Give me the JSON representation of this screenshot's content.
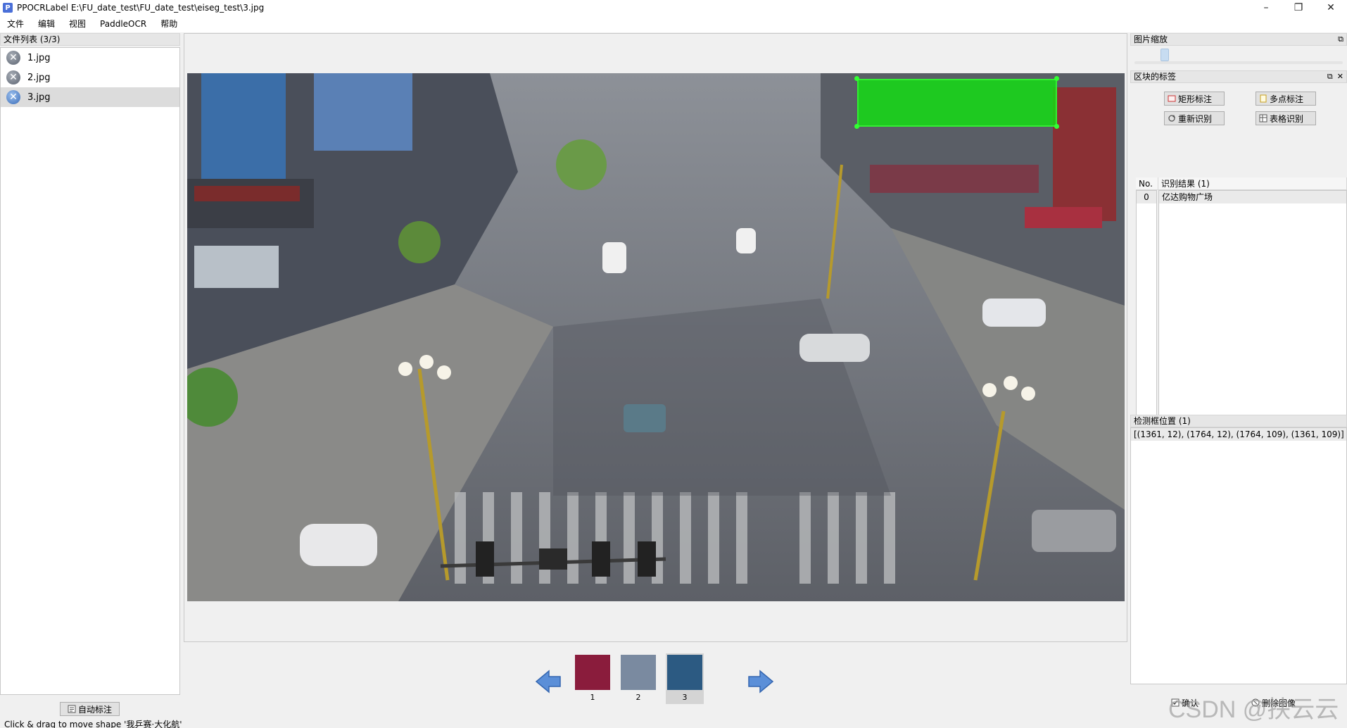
{
  "window": {
    "title": "PPOCRLabel E:\\FU_date_test\\FU_date_test\\eiseg_test\\3.jpg",
    "icon_letter": "P",
    "controls": {
      "minimize": "–",
      "restore": "❐",
      "close": "✕"
    }
  },
  "menu": [
    "文件",
    "编辑",
    "视图",
    "PaddleOCR",
    "帮助"
  ],
  "file_list": {
    "title": "文件列表 (3/3)",
    "items": [
      {
        "name": "1.jpg",
        "selected": false
      },
      {
        "name": "2.jpg",
        "selected": false
      },
      {
        "name": "3.jpg",
        "selected": true
      }
    ]
  },
  "auto_label_button": "自动标注",
  "status_text": "Click & drag to move shape '我乒赛·大化航'",
  "thumbnails": [
    {
      "label": "1",
      "selected": false,
      "color": "#8a1c3c"
    },
    {
      "label": "2",
      "selected": false,
      "color": "#7a8aa0"
    },
    {
      "label": "3",
      "selected": true,
      "color": "#2c5a82"
    }
  ],
  "zoom_dock": {
    "title": "图片缩放",
    "value": 0.13
  },
  "labels_dock": {
    "title": "区块的标签",
    "buttons": {
      "rect": "矩形标注",
      "poly": "多点标注",
      "rerec": "重新识别",
      "table": "表格识别"
    },
    "table": {
      "col_no": "No.",
      "col_res": "识别结果 (1)",
      "rows": [
        {
          "no": "0",
          "text": "亿达购物广场"
        }
      ]
    }
  },
  "position_dock": {
    "title": "检测框位置 (1)",
    "items": [
      "[(1361, 12), (1764, 12), (1764, 109), (1361, 109)]"
    ]
  },
  "bottom_buttons": {
    "confirm": "确认",
    "delete": "删除图像"
  },
  "watermark": "CSDN @扶云云",
  "colors": {
    "bbox_fill": "#14dc14",
    "accent": "#3a6cb8"
  }
}
